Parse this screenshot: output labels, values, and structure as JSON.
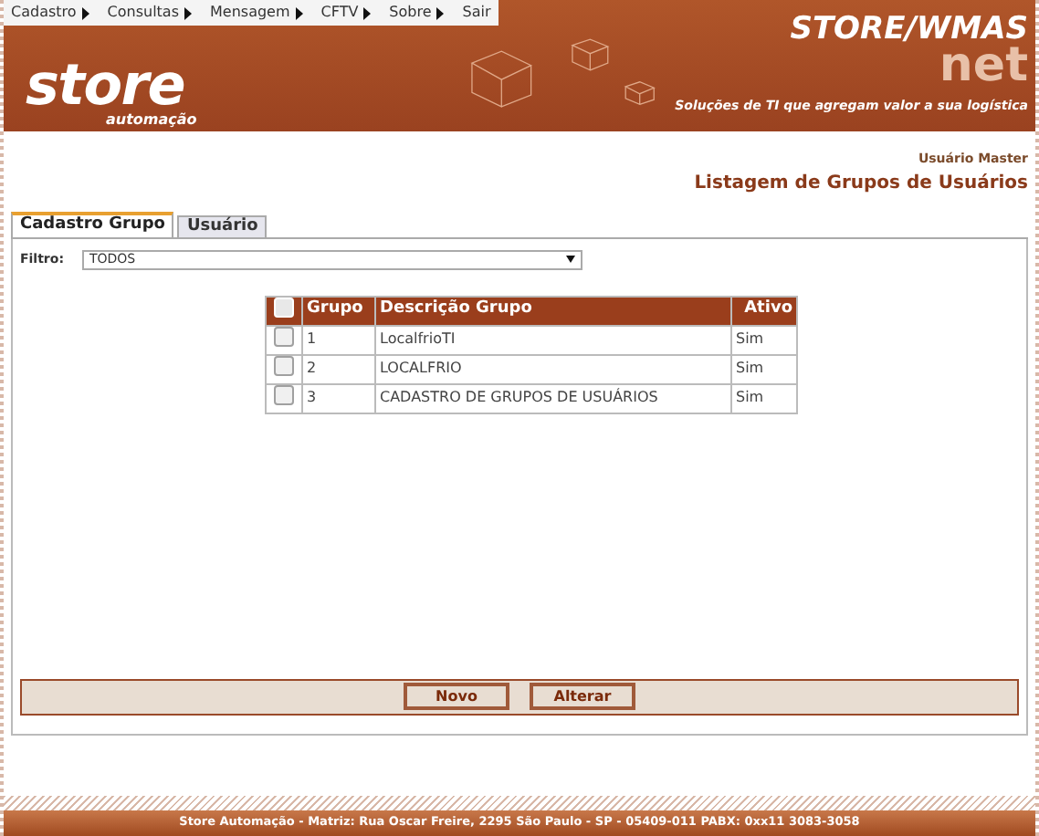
{
  "menu": [
    {
      "label": "Cadastro",
      "submenu": true
    },
    {
      "label": "Consultas",
      "submenu": true
    },
    {
      "label": "Mensagem",
      "submenu": true
    },
    {
      "label": "CFTV",
      "submenu": true
    },
    {
      "label": "Sobre",
      "submenu": true
    },
    {
      "label": "Sair",
      "submenu": false
    }
  ],
  "banner": {
    "logo": "store",
    "logo_sub": "automação",
    "product": "STORE/WMAS",
    "product_sub": "net",
    "tagline": "Soluções de TI que agregam valor a sua logística"
  },
  "user": "Usuário Master",
  "page_title": "Listagem de Grupos de Usuários",
  "tabs": [
    {
      "label": "Cadastro Grupo",
      "selected": true
    },
    {
      "label": "Usuário",
      "selected": false
    }
  ],
  "filter": {
    "label": "Filtro:",
    "value": "TODOS"
  },
  "table": {
    "select_all_checked": false,
    "columns": [
      "Grupo",
      "Descrição Grupo",
      "Ativo"
    ],
    "rows": [
      {
        "checked": false,
        "cells": [
          "1",
          "LocalfrioTI",
          "Sim"
        ]
      },
      {
        "checked": false,
        "cells": [
          "2",
          "LOCALFRIO",
          "Sim"
        ]
      },
      {
        "checked": false,
        "cells": [
          "3",
          "CADASTRO DE GRUPOS DE USUÁRIOS",
          "Sim"
        ]
      }
    ]
  },
  "buttons": [
    "Novo",
    "Alterar"
  ],
  "footer": "Store Automação - Matriz: Rua Oscar Freire, 2295 São Paulo - SP - 05409-011 PABX: 0xx11 3083-3058"
}
